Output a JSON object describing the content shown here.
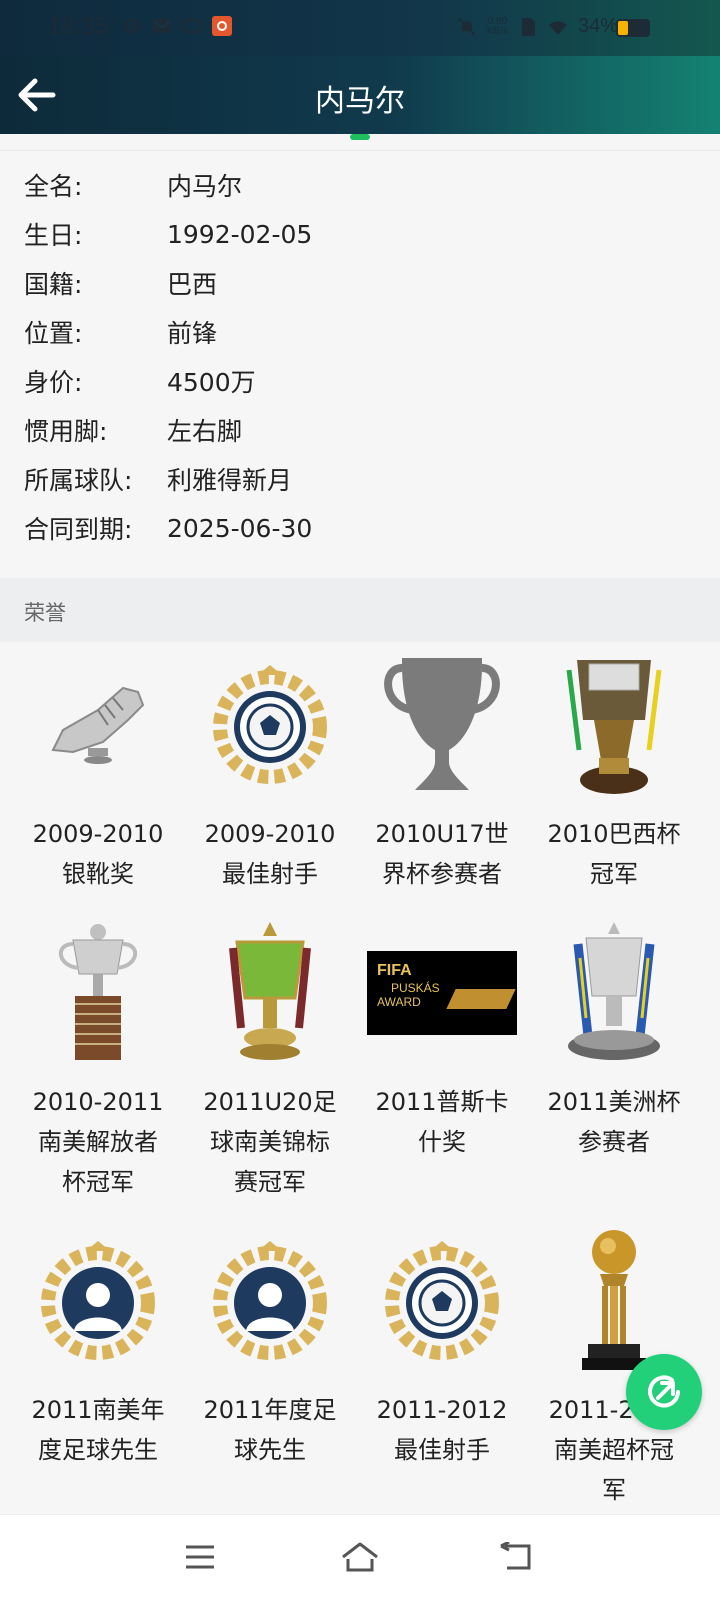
{
  "status_bar": {
    "time": "18:35",
    "net_speed": "0.80",
    "net_unit": "KB/s",
    "battery": "34%",
    "battery_level": 0.34,
    "left_icons": [
      "gear-icon",
      "mail-icon",
      "message-icon",
      "app-badge-icon"
    ],
    "right_icons": [
      "mute-icon",
      "sim-icon",
      "wifi-icon"
    ]
  },
  "app_bar": {
    "title": "内马尔",
    "back_icon": "arrow-left-icon"
  },
  "info": [
    {
      "label": "全名:",
      "value": "内马尔"
    },
    {
      "label": "生日:",
      "value": "1992-02-05"
    },
    {
      "label": "国籍:",
      "value": "巴西"
    },
    {
      "label": "位置:",
      "value": "前锋"
    },
    {
      "label": "身价:",
      "value": "4500万"
    },
    {
      "label": "惯用脚:",
      "value": "左右脚"
    },
    {
      "label": "所属球队:",
      "value": "利雅得新月"
    },
    {
      "label": "合同到期:",
      "value": "2025-06-30"
    }
  ],
  "section_title": "荣誉",
  "honors": [
    {
      "line1": "2009-2010",
      "line2": "银靴奖",
      "line3": "",
      "icon": "silver-boot-icon"
    },
    {
      "line1": "2009-2010",
      "line2": "最佳射手",
      "line3": "",
      "icon": "laurel-ball-icon"
    },
    {
      "line1": "2010U17世",
      "line2": "界杯参赛者",
      "line3": "",
      "icon": "trophy-placeholder-icon"
    },
    {
      "line1": "2010巴西杯",
      "line2": "冠军",
      "line3": "",
      "icon": "brazil-cup-trophy-icon"
    },
    {
      "line1": "2010-2011",
      "line2": "南美解放者",
      "line3": "杯冠军",
      "icon": "libertadores-trophy-icon"
    },
    {
      "line1": "2011U20足",
      "line2": "球南美锦标",
      "line3": "赛冠军",
      "icon": "u20-trophy-icon"
    },
    {
      "line1": "2011普斯卡",
      "line2": "什奖",
      "line3": "",
      "icon": "puskas-award-icon"
    },
    {
      "line1": "2011美洲杯",
      "line2": "参赛者",
      "line3": "",
      "icon": "copa-america-trophy-icon"
    },
    {
      "line1": "2011南美年",
      "line2": "度足球先生",
      "line3": "",
      "icon": "laurel-person-icon"
    },
    {
      "line1": "2011年度足",
      "line2": "球先生",
      "line3": "",
      "icon": "laurel-person-icon"
    },
    {
      "line1": "2011-2012",
      "line2": "最佳射手",
      "line3": "",
      "icon": "laurel-ball-icon"
    },
    {
      "line1": "2011-2012",
      "line2": "南美超杯冠",
      "line3": "军",
      "icon": "golden-ball-trophy-icon"
    }
  ],
  "puskas_text": {
    "line1": "FIFA",
    "line2": "PUSKÁS",
    "line3": "AWARD"
  },
  "fab_icon": "share-icon",
  "nav_icons": [
    "menu-icon",
    "home-icon",
    "back-icon"
  ]
}
